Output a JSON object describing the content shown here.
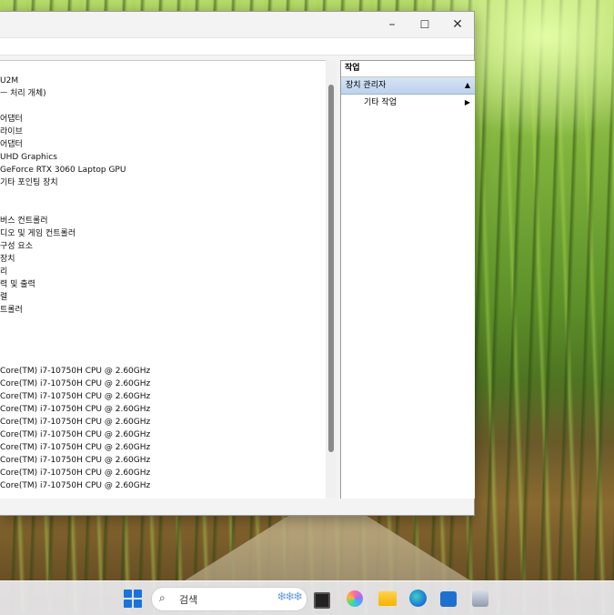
{
  "window": {
    "controls": {
      "minimize": "–",
      "maximize": "☐",
      "close": "✕"
    },
    "tree_rows": [
      "U2M",
      "ᅳ 처리 개체)",
      "",
      "어댑터",
      "라이브",
      " 어댑터",
      "UHD Graphics",
      "GeForce RTX 3060 Laptop GPU",
      "기타 포인팅 장치",
      "",
      "",
      "버스 컨트롤러",
      "디오 및 게임 컨트롤러",
      " 구성 요소",
      " 장치",
      "리",
      "력 및 출력",
      "렬",
      "트롤러",
      "",
      "",
      "",
      "Core(TM) i7-10750H CPU @ 2.60GHz",
      "Core(TM) i7-10750H CPU @ 2.60GHz",
      "Core(TM) i7-10750H CPU @ 2.60GHz",
      "Core(TM) i7-10750H CPU @ 2.60GHz",
      "Core(TM) i7-10750H CPU @ 2.60GHz",
      "Core(TM) i7-10750H CPU @ 2.60GHz",
      "Core(TM) i7-10750H CPU @ 2.60GHz",
      "Core(TM) i7-10750H CPU @ 2.60GHz",
      "Core(TM) i7-10750H CPU @ 2.60GHz",
      "Core(TM) i7-10750H CPU @ 2.60GHz"
    ],
    "actions_panel": {
      "header": "작업",
      "section": "장치 관리자",
      "section_arrow": "▲",
      "item": "기타 작업",
      "item_arrow": "▶"
    }
  },
  "taskbar": {
    "search_placeholder": "검색",
    "search_icon": "search-icon",
    "search_deco": "❄❄❄"
  }
}
